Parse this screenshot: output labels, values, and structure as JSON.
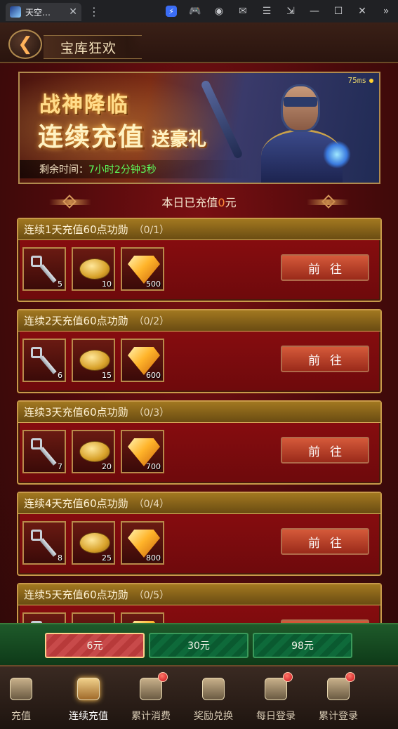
{
  "browser": {
    "tab_title": "天空…",
    "tab_close": "✕",
    "menu_icon": "⋮",
    "buttons": [
      "⚡",
      "🎮",
      "◉",
      "✉",
      "☰",
      "⇲",
      "—",
      "☐",
      "✕",
      "»"
    ]
  },
  "header": {
    "back_icon": "arrow-left-icon",
    "title": "宝库狂欢"
  },
  "banner": {
    "line1": "战神降临",
    "line2_big": "连续充值",
    "line2_small": "送豪礼",
    "timer_label": "剩余时间：",
    "timer_value": "7小时2分钟3秒",
    "ping": "75ms"
  },
  "daily": {
    "prefix": "本日已充值",
    "amount": "0",
    "suffix": "元"
  },
  "cards": [
    {
      "title": "连续1天充值60点功勋",
      "progress": "（0/1）",
      "items": [
        "5",
        "10",
        "500"
      ],
      "button": "前往"
    },
    {
      "title": "连续2天充值60点功勋",
      "progress": "（0/2）",
      "items": [
        "6",
        "15",
        "600"
      ],
      "button": "前往"
    },
    {
      "title": "连续3天充值60点功勋",
      "progress": "（0/3）",
      "items": [
        "7",
        "20",
        "700"
      ],
      "button": "前往"
    },
    {
      "title": "连续4天充值60点功勋",
      "progress": "（0/4）",
      "items": [
        "8",
        "25",
        "800"
      ],
      "button": "前往"
    },
    {
      "title": "连续5天充值60点功勋",
      "progress": "（0/5）",
      "items": [
        "",
        "",
        ""
      ],
      "button": "前往"
    }
  ],
  "amounts": [
    {
      "label": "6元",
      "selected": true
    },
    {
      "label": "30元",
      "selected": false
    },
    {
      "label": "98元",
      "selected": false
    }
  ],
  "nav": [
    {
      "label": "充值",
      "icon": "coin-stack-icon",
      "badge": false,
      "active": false
    },
    {
      "label": "连续充值",
      "icon": "scroll-icon",
      "badge": false,
      "active": true
    },
    {
      "label": "累计消费",
      "icon": "crown-icon",
      "badge": true,
      "active": false
    },
    {
      "label": "奖励兑换",
      "icon": "chest-icon",
      "badge": false,
      "active": false
    },
    {
      "label": "每日登录",
      "icon": "calendar-icon",
      "badge": true,
      "active": false
    },
    {
      "label": "累计登录",
      "icon": "quill-icon",
      "badge": true,
      "active": false
    }
  ],
  "colors": {
    "accent_gold": "#c89a4a",
    "card_red": "#8e0d10",
    "timer_green": "#5cff5c",
    "amount_orange": "#ff8a3a",
    "amount_green": "#0e6a3a"
  }
}
